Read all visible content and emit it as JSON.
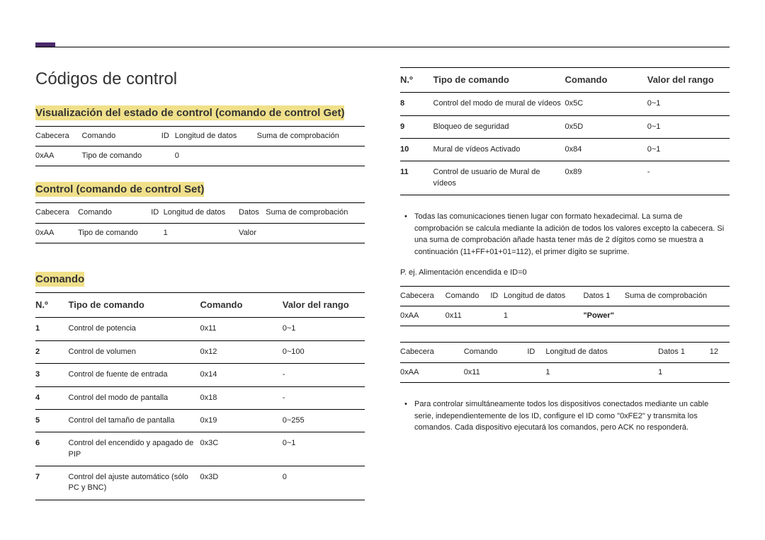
{
  "page_title": "Códigos de control",
  "section_get": {
    "title": "Visualización del estado de control (comando de control Get)",
    "headers": [
      "Cabecera",
      "Comando",
      "ID",
      "Longitud de datos",
      "Suma de comprobación"
    ],
    "row": [
      "0xAA",
      "Tipo de comando",
      "",
      "0",
      ""
    ]
  },
  "section_set": {
    "title": "Control (comando de control Set)",
    "headers": [
      "Cabecera",
      "Comando",
      "ID",
      "Longitud de datos",
      "Datos",
      "Suma de comprobación"
    ],
    "row": [
      "0xAA",
      "Tipo de comando",
      "",
      "1",
      "Valor",
      ""
    ]
  },
  "section_comando_title": "Comando",
  "cmd_headers": [
    "N.º",
    "Tipo de comando",
    "Comando",
    "Valor del rango"
  ],
  "cmd_rows_left": [
    [
      "1",
      "Control de potencia",
      "0x11",
      "0~1"
    ],
    [
      "2",
      "Control de volumen",
      "0x12",
      "0~100"
    ],
    [
      "3",
      "Control de fuente de entrada",
      "0x14",
      "-"
    ],
    [
      "4",
      "Control del modo de pantalla",
      "0x18",
      "-"
    ],
    [
      "5",
      "Control del tamaño de pantalla",
      "0x19",
      "0~255"
    ],
    [
      "6",
      "Control del encendido y apagado de PIP",
      "0x3C",
      "0~1"
    ],
    [
      "7",
      "Control del ajuste automático (sólo PC y BNC)",
      "0x3D",
      "0"
    ]
  ],
  "cmd_rows_right": [
    [
      "8",
      "Control del modo de mural de vídeos",
      "0x5C",
      "0~1"
    ],
    [
      "9",
      "Bloqueo de seguridad",
      "0x5D",
      "0~1"
    ],
    [
      "10",
      "Mural de vídeos Activado",
      "0x84",
      "0~1"
    ],
    [
      "11",
      "Control de usuario de Mural de vídeos",
      "0x89",
      "-"
    ]
  ],
  "bullet1": "Todas las comunicaciones tienen lugar con formato hexadecimal. La suma de comprobación se calcula mediante la adición de todos los valores excepto la cabecera. Si una suma de comprobación añade hasta tener más de 2 dígitos como se muestra a continuación (11+FF+01+01=112), el primer dígito se suprime.",
  "example_label": "P. ej. Alimentación encendida e ID=0",
  "example_table1": {
    "headers": [
      "Cabecera",
      "Comando",
      "ID",
      "Longitud de datos",
      "Datos 1",
      "Suma de comprobación"
    ],
    "row": [
      "0xAA",
      "0x11",
      "",
      "1",
      "\"Power\"",
      ""
    ]
  },
  "example_table2": {
    "headers": [
      "Cabecera",
      "Comando",
      "ID",
      "Longitud de datos",
      "Datos 1",
      "12"
    ],
    "row": [
      "0xAA",
      "0x11",
      "",
      "1",
      "1",
      ""
    ]
  },
  "bullet2": "Para controlar simultáneamente todos los dispositivos conectados mediante un cable serie, independientemente de los ID, configure el ID como \"0xFE2\" y transmita los comandos. Cada dispositivo ejecutará los comandos, pero ACK no responderá."
}
